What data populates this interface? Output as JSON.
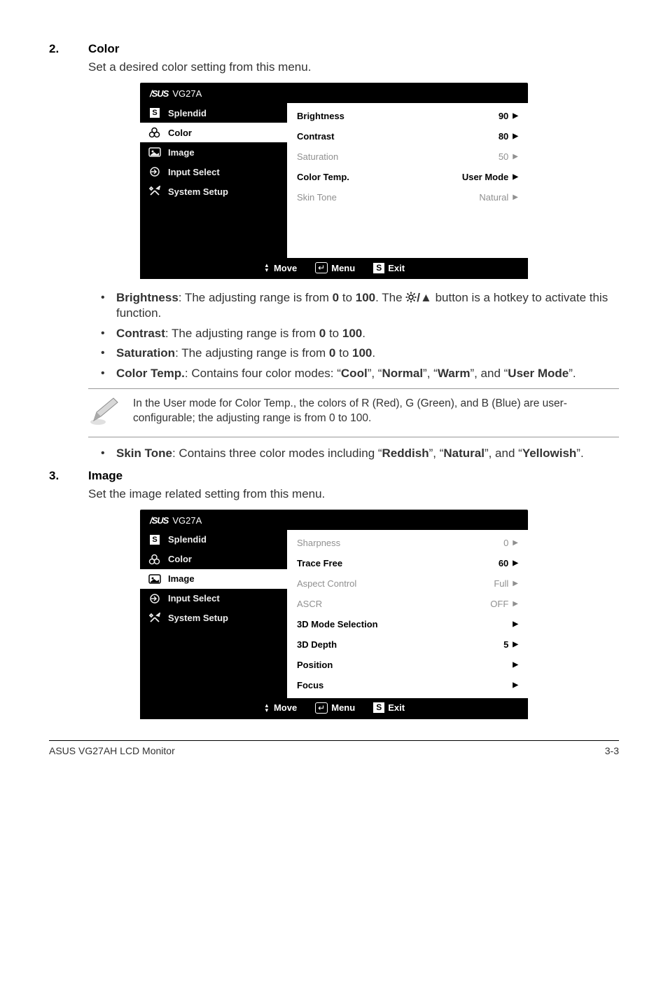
{
  "sections": [
    {
      "number": "2.",
      "title": "Color",
      "description": "Set a desired color setting from this menu.",
      "osd": {
        "model": "VG27A",
        "selected": 1,
        "nav": [
          {
            "label": "Splendid",
            "icon": "s"
          },
          {
            "label": "Color",
            "icon": "palette"
          },
          {
            "label": "Image",
            "icon": "picture"
          },
          {
            "label": "Input Select",
            "icon": "input"
          },
          {
            "label": "System Setup",
            "icon": "tools"
          }
        ],
        "options": [
          {
            "label": "Brightness",
            "value": "90",
            "arrow": true,
            "style": "bold"
          },
          {
            "label": "Contrast",
            "value": "80",
            "arrow": true,
            "style": "bold"
          },
          {
            "label": "Saturation",
            "value": "50",
            "arrow": true,
            "style": "dim"
          },
          {
            "label": "Color Temp.",
            "value": "User Mode",
            "arrow": true,
            "style": "bold"
          },
          {
            "label": "Skin Tone",
            "value": "Natural",
            "arrow": true,
            "style": "dim"
          }
        ],
        "spacer": true,
        "footer": {
          "move": "Move",
          "menu": "Menu",
          "exit": "Exit"
        }
      },
      "bullets1": [
        {
          "html": "<span class=\"b\">Brightness</span>: The adjusting range is from <span class=\"b\">0</span> to <span class=\"b\">100</span>. The <svg class=\"glyph-sun\" width=\"16\" height=\"16\" viewBox=\"0 0 16 16\"><circle cx=\"8\" cy=\"8\" r=\"3\" fill=\"none\" stroke=\"#000\" stroke-width=\"1.5\"/><g stroke=\"#000\" stroke-width=\"1.5\"><line x1=\"8\" y1=\"0.5\" x2=\"8\" y2=\"3\"/><line x1=\"8\" y1=\"13\" x2=\"8\" y2=\"15.5\"/><line x1=\"0.5\" y1=\"8\" x2=\"3\" y2=\"8\"/><line x1=\"13\" y1=\"8\" x2=\"15.5\" y2=\"8\"/><line x1=\"2.5\" y1=\"2.5\" x2=\"4.5\" y2=\"4.5\"/><line x1=\"11.5\" y1=\"11.5\" x2=\"13.5\" y2=\"13.5\"/><line x1=\"2.5\" y1=\"13.5\" x2=\"4.5\" y2=\"11.5\"/><line x1=\"11.5\" y1=\"4.5\" x2=\"13.5\" y2=\"2.5\"/></g></svg><span class=\"b\">/▲</span> button is a hotkey to activate this function."
        },
        {
          "html": "<span class=\"b\">Contrast</span>: The adjusting range is from <span class=\"b\">0</span> to <span class=\"b\">100</span>."
        },
        {
          "html": "<span class=\"b\">Saturation</span>: The adjusting range is from <span class=\"b\">0</span> to <span class=\"b\">100</span>."
        },
        {
          "html": "<span class=\"b\">Color Temp.</span>: Contains four color modes: &ldquo;<span class=\"b\">Cool</span>&rdquo;, &ldquo;<span class=\"b\">Normal</span>&rdquo;, &ldquo;<span class=\"b\">Warm</span>&rdquo;, and &ldquo;<span class=\"b\">User Mode</span>&rdquo;."
        }
      ],
      "note": "In the User mode for Color Temp., the colors of R (Red), G (Green), and B (Blue) are user-configurable; the adjusting range is from 0 to 100.",
      "bullets2": [
        {
          "html": "<span class=\"b\">Skin Tone</span>: Contains three color modes including &ldquo;<span class=\"b\">Reddish</span>&rdquo;, &ldquo;<span class=\"b\">Natural</span>&rdquo;, and &ldquo;<span class=\"b\">Yellowish</span>&rdquo;."
        }
      ]
    },
    {
      "number": "3.",
      "title": "Image",
      "description": "Set the image related setting from this menu.",
      "osd": {
        "model": "VG27A",
        "selected": 2,
        "nav": [
          {
            "label": "Splendid",
            "icon": "s"
          },
          {
            "label": "Color",
            "icon": "palette"
          },
          {
            "label": "Image",
            "icon": "picture"
          },
          {
            "label": "Input Select",
            "icon": "input"
          },
          {
            "label": "System Setup",
            "icon": "tools"
          }
        ],
        "options": [
          {
            "label": "Sharpness",
            "value": "0",
            "arrow": true,
            "style": "dim"
          },
          {
            "label": "Trace Free",
            "value": "60",
            "arrow": true,
            "style": "bold"
          },
          {
            "label": "Aspect Control",
            "value": "Full",
            "arrow": true,
            "style": "dim"
          },
          {
            "label": "ASCR",
            "value": "OFF",
            "arrow": true,
            "style": "dim"
          },
          {
            "label": "3D Mode Selection",
            "value": "",
            "arrow": true,
            "style": "bold"
          },
          {
            "label": "3D Depth",
            "value": "5",
            "arrow": true,
            "style": "bold"
          },
          {
            "label": "Position",
            "value": "",
            "arrow": true,
            "style": "bold"
          },
          {
            "label": "Focus",
            "value": "",
            "arrow": true,
            "style": "bold"
          }
        ],
        "spacer": false,
        "footer": {
          "move": "Move",
          "menu": "Menu",
          "exit": "Exit"
        }
      }
    }
  ],
  "footer": {
    "left": "ASUS VG27AH LCD Monitor",
    "right": "3-3"
  }
}
